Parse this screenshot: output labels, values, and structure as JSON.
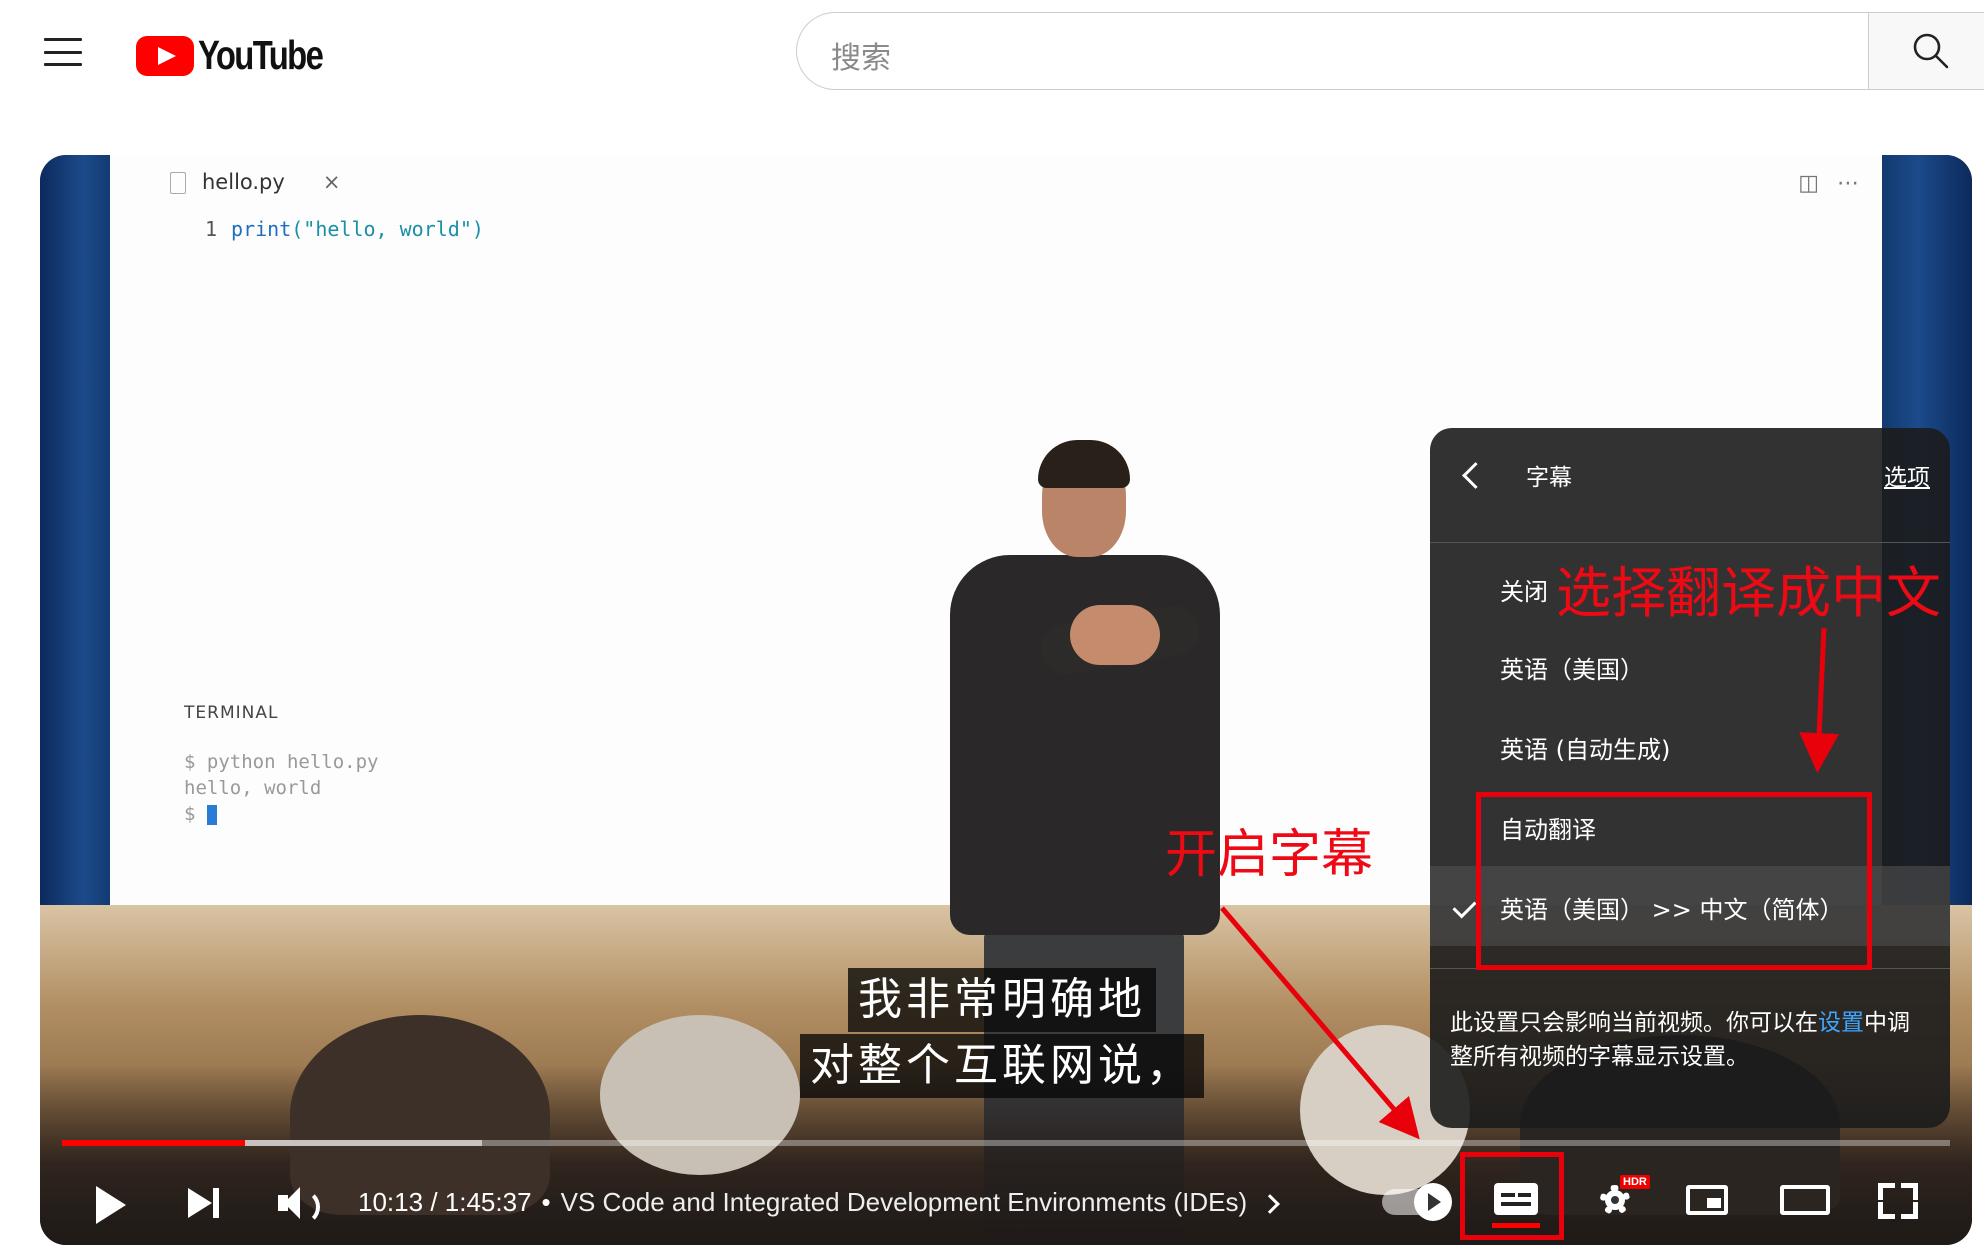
{
  "header": {
    "logo_text": "YouTube",
    "search_placeholder": "搜索"
  },
  "editor": {
    "tab_filename": "hello.py",
    "tab_close": "×",
    "code_line_number": "1",
    "code_fn": "print",
    "code_args": "(\"hello, world\")",
    "terminal_title": "TERMINAL",
    "terminal_command": "$ python hello.py",
    "terminal_output": "hello, world",
    "terminal_prompt": "$"
  },
  "captions": {
    "line1": "我非常明确地",
    "line2": "对整个互联网说，"
  },
  "subtitle_menu": {
    "title": "字幕",
    "options_link": "选项",
    "items": [
      {
        "label": "关闭",
        "selected": false
      },
      {
        "label": "英语（美国）",
        "selected": false
      },
      {
        "label": "英语 (自动生成)",
        "selected": false
      },
      {
        "label": "自动翻译",
        "selected": false
      },
      {
        "label": "英语（美国） >> 中文（简体）",
        "selected": true
      }
    ],
    "footer_text_1": "此设置只会影响当前视频。你可以在",
    "footer_link": "设置",
    "footer_text_2": "中调整所有视频的字幕显示设置。"
  },
  "player": {
    "current_time": "10:13",
    "separator": "/",
    "duration": "1:45:37",
    "dot": "•",
    "chapter_title": "VS Code and Integrated Development Environments (IDEs)",
    "hdr_badge": "HDR",
    "progress_fraction": 0.097,
    "accent_color": "#ff0000"
  },
  "annotations": {
    "choose_translate": "选择翻译成中文",
    "enable_subtitles": "开启字幕",
    "color": "#e8000b"
  }
}
